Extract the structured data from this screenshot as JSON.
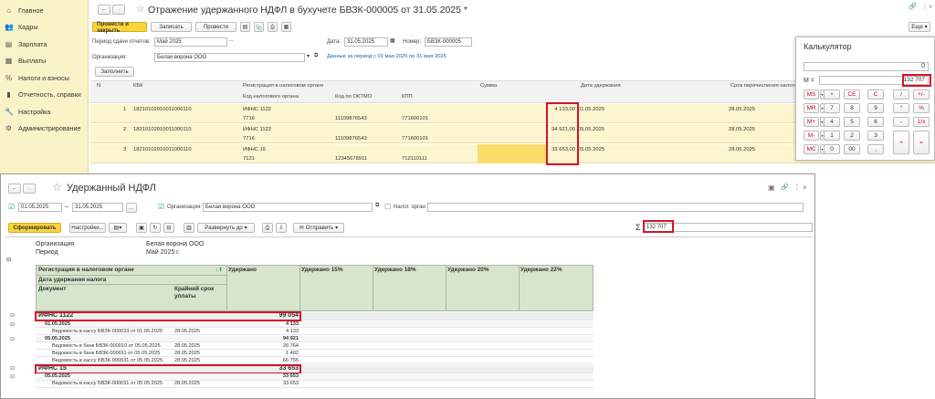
{
  "sidebar": {
    "items": [
      {
        "icon": "home-icon",
        "glyph": "⌂",
        "label": "Главное"
      },
      {
        "icon": "people-icon",
        "glyph": "👥",
        "label": "Кадры"
      },
      {
        "icon": "salary-icon",
        "glyph": "▤",
        "label": "Зарплата"
      },
      {
        "icon": "payments-icon",
        "glyph": "▦",
        "label": "Выплаты"
      },
      {
        "icon": "percent-icon",
        "glyph": "%",
        "label": "Налоги и взносы"
      },
      {
        "icon": "chart-icon",
        "glyph": "▮",
        "label": "Отчетность, справки"
      },
      {
        "icon": "wrench-icon",
        "glyph": "🔧",
        "label": "Настройка"
      },
      {
        "icon": "gear-icon",
        "glyph": "⚙",
        "label": "Администрирование"
      }
    ]
  },
  "doc": {
    "title": "Отражение удержанного НДФЛ в бухучете БВЗК-000005 от 31.05.2025 *",
    "post_close": "Провести и закрыть",
    "save": "Записать",
    "post": "Провести",
    "more": "Еще",
    "period_label": "Период сдачи отчетов:",
    "period_value": "Май 2025",
    "date_label": "Дата:",
    "date_value": "31.05.2025",
    "number_label": "Номер:",
    "number_value": "БВЗК-000005",
    "org_label": "Организация:",
    "org_value": "Белая ворона ООО",
    "link": "Данные за период с 01 мая 2025 по 31 мая 2025",
    "fill": "Заполнить",
    "headers": {
      "n": "N",
      "kbk": "КБК",
      "reg": "Регистрация в налоговом органе",
      "tax_code": "Код налогового органа",
      "oktmo": "Код по ОКТМО",
      "kpp": "КПП",
      "sum": "Сумма",
      "date_withheld": "Дата удержания",
      "transfer_date": "Срок перечисления налога"
    },
    "rows": [
      {
        "n": "1",
        "kbk": "18210102010011000110",
        "reg": "ИФНС 1122",
        "code": "7716",
        "oktmo": "11109876543",
        "kpp": "771600101",
        "sum": "4 133,00",
        "date": "01.05.2025",
        "due": "28.05.2025"
      },
      {
        "n": "2",
        "kbk": "18210102010011000110",
        "reg": "ИФНС 1122",
        "code": "7716",
        "oktmo": "11109876543",
        "kpp": "771600101",
        "sum": "94 921,00",
        "date": "05.05.2025",
        "due": "28.05.2025"
      },
      {
        "n": "3",
        "kbk": "18210102010011000110",
        "reg": "ИФНС 15",
        "code": "7121",
        "oktmo": "12345678911",
        "kpp": "712110111",
        "sum": "33 653,00",
        "date": "05.05.2025",
        "due": "28.05.2025"
      }
    ]
  },
  "calc": {
    "title": "Калькулятор",
    "display": "0",
    "memory_label": "M =",
    "memory_value": "132 707",
    "rows": [
      [
        "MS",
        "+",
        "CE",
        "C",
        "/",
        "+/-"
      ],
      [
        "MR",
        "7",
        "8",
        "9",
        "*",
        "%"
      ],
      [
        "M+",
        "4",
        "5",
        "6",
        "-",
        "1/x"
      ],
      [
        "M-",
        "1",
        "2",
        "3",
        "+",
        "="
      ],
      [
        "MC",
        "0",
        "00",
        ","
      ]
    ]
  },
  "report": {
    "title": "Удержанный НДФЛ",
    "date_from": "01.05.2025",
    "dash": "–",
    "date_to": "31.05.2025",
    "org_label": "Организация:",
    "org_value": "Белая ворона ООО",
    "tax_label": "Налог. орган:",
    "generate": "Сформировать",
    "settings": "Настройки...",
    "expand": "Развернуть до",
    "send": "Отправить",
    "sigma": "Σ",
    "total": "132 707",
    "meta": [
      {
        "k": "Организация",
        "v": "Белая ворона ООО"
      },
      {
        "k": "Период",
        "v": "Май 2025 г."
      }
    ],
    "col_reg": "Регистрация в налоговом органе",
    "col_date": "Дата удержания налога",
    "col_doc": "Документ",
    "col_due": "Крайний срок уплаты",
    "cols": [
      "Удержано",
      "Удержано 15%",
      "Удержано 18%",
      "Удержано 20%",
      "Удержано 22%"
    ],
    "lines": [
      {
        "kind": "group",
        "label": "ИФНС 1122",
        "value": "99 054"
      },
      {
        "kind": "date",
        "label": "01.05.2025",
        "value": "4 133"
      },
      {
        "kind": "doc",
        "label": "Ведомость в кассу БВЗК-000033 от 01.05.2025",
        "due": "28.05.2025",
        "value": "4 133"
      },
      {
        "kind": "date",
        "label": "05.05.2025",
        "value": "94 921"
      },
      {
        "kind": "doc",
        "label": "Ведомость в банк БВЗК-000010 от 05.05.2025",
        "due": "28.05.2025",
        "value": "26 764"
      },
      {
        "kind": "doc",
        "label": "Ведомость в банк БВЗК-000011 от 05.05.2025",
        "due": "28.05.2025",
        "value": "1 402"
      },
      {
        "kind": "doc",
        "label": "Ведомость в кассу БВЗК-000031 от 05.05.2025",
        "due": "28.05.2025",
        "value": "66 755"
      },
      {
        "kind": "group",
        "label": "ИФНС 15",
        "value": "33 653"
      },
      {
        "kind": "date",
        "label": "05.05.2025",
        "value": "33 653"
      },
      {
        "kind": "doc",
        "label": "Ведомость в кассу БВЗК-000031 от 05.05.2025",
        "due": "28.05.2025",
        "value": "33 653"
      }
    ]
  }
}
